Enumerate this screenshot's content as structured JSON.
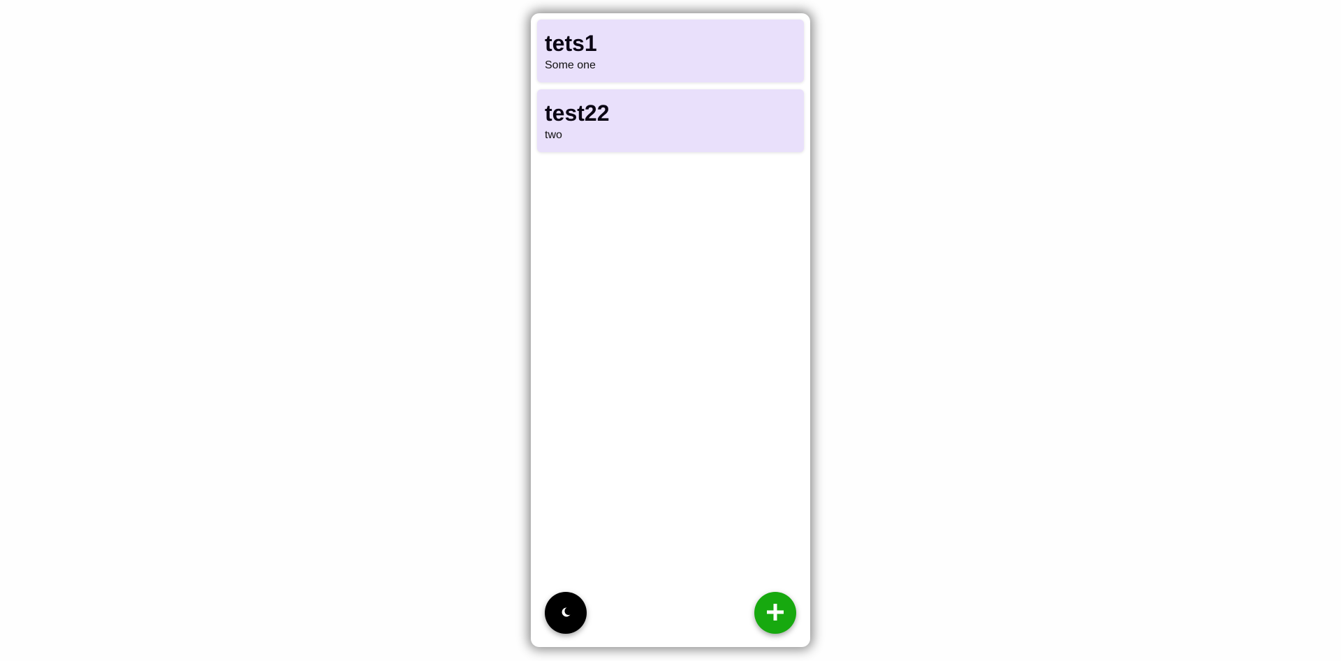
{
  "notes": [
    {
      "title": "tets1",
      "body": "Some one"
    },
    {
      "title": "test22",
      "body": "two"
    }
  ],
  "buttons": {
    "theme_icon": "moon-icon",
    "add_icon": "plus-icon"
  },
  "colors": {
    "note_background": "#e9e0fb",
    "theme_button": "#000000",
    "add_button": "#17a90f"
  }
}
